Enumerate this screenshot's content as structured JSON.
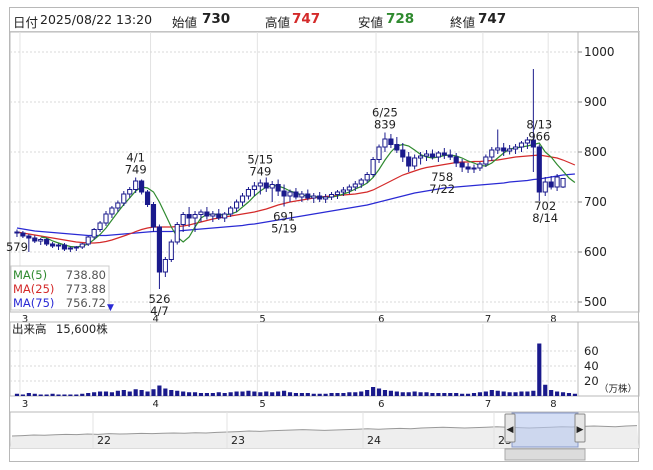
{
  "header": {
    "date_label": "日付",
    "date_value": "2025/08/22 13:20",
    "open_label": "始値",
    "open_value": "730",
    "high_label": "高値",
    "high_value": "747",
    "low_label": "安値",
    "low_value": "728",
    "close_label": "終値",
    "close_value": "747"
  },
  "colors": {
    "up": "#1a1a8c",
    "candle_body": "#1a1a8c",
    "ma5": "#2f8a2f",
    "ma25": "#d42a2a",
    "ma75": "#2a2ad4",
    "volume": "#1a1a8c",
    "high_value": "#d42a2a",
    "low_value": "#2f8a2f",
    "grid": "#d8d8d8"
  },
  "legend": [
    {
      "label": "MA(5)",
      "value": "738.80",
      "color": "#2f8a2f"
    },
    {
      "label": "MA(25)",
      "value": "773.88",
      "color": "#d42a2a"
    },
    {
      "label": "MA(75)",
      "value": "756.72",
      "color": "#2a2ad4"
    }
  ],
  "legend_toggle_icon": "▼",
  "price_axis": {
    "ticks": [
      "1000",
      "900",
      "800",
      "700",
      "600",
      "500"
    ]
  },
  "month_ticks": [
    "3",
    "4",
    "5",
    "6",
    "7",
    "8"
  ],
  "annotations": [
    {
      "lines": [
        "579"
      ],
      "side": "below"
    },
    {
      "lines": [
        "4/1",
        "749"
      ],
      "side": "above"
    },
    {
      "lines": [
        "526",
        "4/7"
      ],
      "side": "below"
    },
    {
      "lines": [
        "5/15",
        "749"
      ],
      "side": "above"
    },
    {
      "lines": [
        "691",
        "5/19"
      ],
      "side": "below"
    },
    {
      "lines": [
        "6/25",
        "839"
      ],
      "side": "above"
    },
    {
      "lines": [
        "758",
        "7/22"
      ],
      "side": "below"
    },
    {
      "lines": [
        "8/13",
        "966"
      ],
      "side": "above"
    },
    {
      "lines": [
        "702",
        "8/14"
      ],
      "side": "below"
    }
  ],
  "volume": {
    "title": "出来高",
    "value": "15,600株",
    "ticks": [
      "60",
      "40",
      "20"
    ],
    "unit": "（万株）"
  },
  "navigator": {
    "date_ticks": [
      "22",
      "23",
      "24",
      "25"
    ],
    "left_handle_icon": "◀",
    "right_handle_icon": "▶"
  },
  "chart_data": {
    "type": "candlestick",
    "ylim": [
      480,
      1040
    ],
    "candles": [
      {
        "o": 640,
        "h": 645,
        "l": 630,
        "c": 638
      },
      {
        "o": 638,
        "h": 642,
        "l": 628,
        "c": 632
      },
      {
        "o": 632,
        "h": 636,
        "l": 600,
        "c": 628
      },
      {
        "o": 628,
        "h": 633,
        "l": 618,
        "c": 622
      },
      {
        "o": 622,
        "h": 628,
        "l": 614,
        "c": 625
      },
      {
        "o": 625,
        "h": 628,
        "l": 612,
        "c": 616
      },
      {
        "o": 616,
        "h": 620,
        "l": 608,
        "c": 612
      },
      {
        "o": 612,
        "h": 617,
        "l": 604,
        "c": 614
      },
      {
        "o": 614,
        "h": 618,
        "l": 602,
        "c": 606
      },
      {
        "o": 606,
        "h": 611,
        "l": 600,
        "c": 608
      },
      {
        "o": 608,
        "h": 612,
        "l": 602,
        "c": 610
      },
      {
        "o": 610,
        "h": 618,
        "l": 606,
        "c": 616
      },
      {
        "o": 616,
        "h": 632,
        "l": 612,
        "c": 630
      },
      {
        "o": 630,
        "h": 648,
        "l": 625,
        "c": 645
      },
      {
        "o": 645,
        "h": 662,
        "l": 640,
        "c": 658
      },
      {
        "o": 658,
        "h": 682,
        "l": 652,
        "c": 676
      },
      {
        "o": 676,
        "h": 692,
        "l": 668,
        "c": 688
      },
      {
        "o": 688,
        "h": 703,
        "l": 680,
        "c": 698
      },
      {
        "o": 698,
        "h": 722,
        "l": 692,
        "c": 716
      },
      {
        "o": 716,
        "h": 730,
        "l": 708,
        "c": 725
      },
      {
        "o": 725,
        "h": 749,
        "l": 718,
        "c": 742
      },
      {
        "o": 742,
        "h": 745,
        "l": 715,
        "c": 720
      },
      {
        "o": 720,
        "h": 724,
        "l": 690,
        "c": 695
      },
      {
        "o": 695,
        "h": 700,
        "l": 640,
        "c": 650
      },
      {
        "o": 650,
        "h": 655,
        "l": 526,
        "c": 560
      },
      {
        "o": 560,
        "h": 590,
        "l": 550,
        "c": 585
      },
      {
        "o": 585,
        "h": 625,
        "l": 580,
        "c": 620
      },
      {
        "o": 620,
        "h": 660,
        "l": 615,
        "c": 655
      },
      {
        "o": 655,
        "h": 680,
        "l": 640,
        "c": 675
      },
      {
        "o": 675,
        "h": 690,
        "l": 650,
        "c": 668
      },
      {
        "o": 668,
        "h": 682,
        "l": 640,
        "c": 675
      },
      {
        "o": 675,
        "h": 685,
        "l": 660,
        "c": 680
      },
      {
        "o": 680,
        "h": 690,
        "l": 665,
        "c": 672
      },
      {
        "o": 672,
        "h": 682,
        "l": 660,
        "c": 676
      },
      {
        "o": 676,
        "h": 686,
        "l": 664,
        "c": 668
      },
      {
        "o": 668,
        "h": 680,
        "l": 660,
        "c": 676
      },
      {
        "o": 676,
        "h": 692,
        "l": 670,
        "c": 688
      },
      {
        "o": 688,
        "h": 705,
        "l": 680,
        "c": 700
      },
      {
        "o": 700,
        "h": 718,
        "l": 692,
        "c": 712
      },
      {
        "o": 712,
        "h": 730,
        "l": 705,
        "c": 725
      },
      {
        "o": 725,
        "h": 740,
        "l": 712,
        "c": 732
      },
      {
        "o": 732,
        "h": 745,
        "l": 715,
        "c": 738
      },
      {
        "o": 738,
        "h": 749,
        "l": 720,
        "c": 728
      },
      {
        "o": 728,
        "h": 742,
        "l": 700,
        "c": 735
      },
      {
        "o": 735,
        "h": 745,
        "l": 712,
        "c": 722
      },
      {
        "o": 722,
        "h": 735,
        "l": 691,
        "c": 712
      },
      {
        "o": 712,
        "h": 725,
        "l": 700,
        "c": 720
      },
      {
        "o": 720,
        "h": 728,
        "l": 705,
        "c": 710
      },
      {
        "o": 710,
        "h": 722,
        "l": 700,
        "c": 716
      },
      {
        "o": 716,
        "h": 725,
        "l": 703,
        "c": 708
      },
      {
        "o": 708,
        "h": 718,
        "l": 698,
        "c": 712
      },
      {
        "o": 712,
        "h": 720,
        "l": 700,
        "c": 706
      },
      {
        "o": 706,
        "h": 716,
        "l": 698,
        "c": 710
      },
      {
        "o": 710,
        "h": 720,
        "l": 704,
        "c": 715
      },
      {
        "o": 715,
        "h": 724,
        "l": 706,
        "c": 720
      },
      {
        "o": 720,
        "h": 730,
        "l": 712,
        "c": 724
      },
      {
        "o": 724,
        "h": 735,
        "l": 716,
        "c": 730
      },
      {
        "o": 730,
        "h": 742,
        "l": 722,
        "c": 736
      },
      {
        "o": 736,
        "h": 748,
        "l": 728,
        "c": 744
      },
      {
        "o": 744,
        "h": 760,
        "l": 738,
        "c": 755
      },
      {
        "o": 755,
        "h": 790,
        "l": 750,
        "c": 785
      },
      {
        "o": 785,
        "h": 815,
        "l": 778,
        "c": 810
      },
      {
        "o": 810,
        "h": 839,
        "l": 800,
        "c": 826
      },
      {
        "o": 826,
        "h": 836,
        "l": 808,
        "c": 815
      },
      {
        "o": 815,
        "h": 830,
        "l": 798,
        "c": 804
      },
      {
        "o": 804,
        "h": 818,
        "l": 780,
        "c": 790
      },
      {
        "o": 790,
        "h": 800,
        "l": 760,
        "c": 772
      },
      {
        "o": 772,
        "h": 795,
        "l": 765,
        "c": 788
      },
      {
        "o": 788,
        "h": 800,
        "l": 775,
        "c": 792
      },
      {
        "o": 792,
        "h": 804,
        "l": 782,
        "c": 796
      },
      {
        "o": 796,
        "h": 805,
        "l": 785,
        "c": 790
      },
      {
        "o": 790,
        "h": 802,
        "l": 780,
        "c": 798
      },
      {
        "o": 798,
        "h": 808,
        "l": 786,
        "c": 794
      },
      {
        "o": 794,
        "h": 805,
        "l": 784,
        "c": 790
      },
      {
        "o": 790,
        "h": 798,
        "l": 770,
        "c": 778
      },
      {
        "o": 778,
        "h": 786,
        "l": 760,
        "c": 770
      },
      {
        "o": 770,
        "h": 778,
        "l": 758,
        "c": 766
      },
      {
        "o": 766,
        "h": 775,
        "l": 758,
        "c": 768
      },
      {
        "o": 768,
        "h": 780,
        "l": 762,
        "c": 776
      },
      {
        "o": 776,
        "h": 795,
        "l": 770,
        "c": 790
      },
      {
        "o": 790,
        "h": 810,
        "l": 782,
        "c": 804
      },
      {
        "o": 804,
        "h": 845,
        "l": 796,
        "c": 808
      },
      {
        "o": 808,
        "h": 818,
        "l": 792,
        "c": 802
      },
      {
        "o": 802,
        "h": 814,
        "l": 795,
        "c": 806
      },
      {
        "o": 806,
        "h": 816,
        "l": 796,
        "c": 810
      },
      {
        "o": 810,
        "h": 822,
        "l": 800,
        "c": 818
      },
      {
        "o": 818,
        "h": 830,
        "l": 806,
        "c": 824
      },
      {
        "o": 824,
        "h": 966,
        "l": 760,
        "c": 810
      },
      {
        "o": 810,
        "h": 815,
        "l": 702,
        "c": 720
      },
      {
        "o": 720,
        "h": 750,
        "l": 712,
        "c": 740
      },
      {
        "o": 740,
        "h": 752,
        "l": 725,
        "c": 730
      },
      {
        "o": 730,
        "h": 756,
        "l": 722,
        "c": 750
      },
      {
        "o": 730,
        "h": 747,
        "l": 728,
        "c": 747
      }
    ],
    "ma": {
      "ma5": [
        null,
        null,
        null,
        null,
        630,
        628,
        622,
        618,
        614,
        611,
        610,
        612,
        616,
        625,
        635,
        648,
        664,
        680,
        695,
        708,
        722,
        730,
        728,
        720,
        700,
        675,
        650,
        630,
        620,
        630,
        650,
        668,
        675,
        676,
        675,
        674,
        676,
        680,
        690,
        700,
        712,
        722,
        730,
        733,
        732,
        728,
        722,
        718,
        714,
        712,
        711,
        710,
        709,
        710,
        712,
        716,
        720,
        726,
        731,
        738,
        749,
        765,
        784,
        800,
        812,
        815,
        812,
        804,
        795,
        790,
        788,
        790,
        793,
        794,
        792,
        788,
        782,
        778,
        773,
        772,
        778,
        788,
        798,
        806,
        808,
        810,
        812,
        815,
        818,
        800,
        790,
        775,
        762,
        748,
        739
      ],
      "ma25": [
        640,
        638,
        636,
        634,
        632,
        630,
        628,
        626,
        624,
        622,
        620,
        619,
        618,
        618,
        619,
        621,
        624,
        628,
        632,
        636,
        641,
        645,
        648,
        650,
        650,
        650,
        650,
        651,
        652,
        654,
        657,
        660,
        663,
        666,
        668,
        670,
        672,
        674,
        676,
        678,
        680,
        683,
        686,
        690,
        694,
        697,
        700,
        702,
        704,
        706,
        708,
        710,
        711,
        712,
        713,
        714,
        715,
        716,
        718,
        720,
        724,
        730,
        736,
        742,
        748,
        754,
        758,
        762,
        766,
        769,
        771,
        773,
        775,
        777,
        779,
        780,
        780,
        781,
        781,
        782,
        783,
        784,
        786,
        788,
        790,
        791,
        792,
        793,
        794,
        792,
        790,
        788,
        784,
        779,
        774
      ],
      "ma75": [
        648,
        646,
        644,
        642,
        641,
        640,
        639,
        638,
        637,
        636,
        635,
        634,
        633,
        633,
        633,
        633,
        634,
        635,
        636,
        637,
        638,
        639,
        640,
        641,
        641,
        641,
        641,
        642,
        643,
        644,
        645,
        646,
        647,
        648,
        649,
        650,
        651,
        652,
        653,
        655,
        656,
        658,
        660,
        662,
        664,
        666,
        668,
        670,
        672,
        674,
        676,
        678,
        680,
        682,
        684,
        686,
        688,
        690,
        692,
        694,
        697,
        700,
        703,
        706,
        709,
        712,
        715,
        718,
        720,
        722,
        724,
        726,
        728,
        729,
        730,
        731,
        732,
        733,
        734,
        735,
        736,
        737,
        738,
        740,
        741,
        742,
        743,
        745,
        746,
        748,
        750,
        752,
        754,
        755,
        756
      ]
    },
    "volume": [
      3,
      2,
      4,
      3,
      2,
      2,
      3,
      2,
      2,
      2,
      2,
      3,
      4,
      5,
      6,
      6,
      5,
      7,
      8,
      6,
      9,
      8,
      6,
      9,
      14,
      10,
      8,
      7,
      6,
      5,
      5,
      4,
      4,
      4,
      5,
      4,
      5,
      6,
      6,
      7,
      6,
      5,
      6,
      5,
      6,
      7,
      5,
      4,
      4,
      4,
      3,
      3,
      3,
      4,
      4,
      4,
      5,
      5,
      6,
      8,
      12,
      10,
      8,
      7,
      6,
      5,
      5,
      6,
      5,
      5,
      4,
      4,
      4,
      4,
      4,
      3,
      3,
      4,
      5,
      6,
      8,
      7,
      6,
      5,
      5,
      6,
      6,
      7,
      70,
      15,
      8,
      6,
      5,
      4,
      3
    ],
    "navigator_line": [
      0.3,
      0.32,
      0.35,
      0.34,
      0.36,
      0.38,
      0.37,
      0.4,
      0.38,
      0.42,
      0.4,
      0.41,
      0.43,
      0.42,
      0.44,
      0.45,
      0.44,
      0.46,
      0.45,
      0.48,
      0.5,
      0.52,
      0.55,
      0.53,
      0.56,
      0.58,
      0.6,
      0.62,
      0.6,
      0.58,
      0.6,
      0.62,
      0.64,
      0.66,
      0.64,
      0.66,
      0.68,
      0.66,
      0.7,
      0.72,
      0.74,
      0.72,
      0.7,
      0.72,
      0.74,
      0.76,
      0.74,
      0.72,
      0.7,
      0.72,
      0.74,
      0.76,
      0.75,
      0.78,
      0.8,
      0.78,
      0.76,
      0.8,
      0.82
    ]
  }
}
